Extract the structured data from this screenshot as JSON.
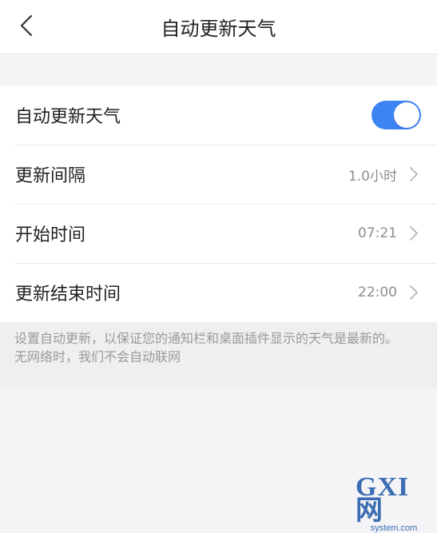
{
  "header": {
    "title": "自动更新天气",
    "back_icon": "chevron-left-icon"
  },
  "settings": {
    "auto_update": {
      "label": "自动更新天气",
      "enabled": true,
      "toggle_color": "#3d84f3"
    },
    "interval": {
      "label": "更新间隔",
      "value": "1.0小时"
    },
    "start_time": {
      "label": "开始时间",
      "value": "07:21"
    },
    "end_time": {
      "label": "更新结束时间",
      "value": "22:00"
    }
  },
  "notes": {
    "line1": "设置自动更新，以保证您的通知栏和桌面插件显示的天气是最新的。",
    "line2": "无网络时，我们不会自动联网"
  },
  "watermark": {
    "logo": "GXI网",
    "site": "system.com"
  }
}
